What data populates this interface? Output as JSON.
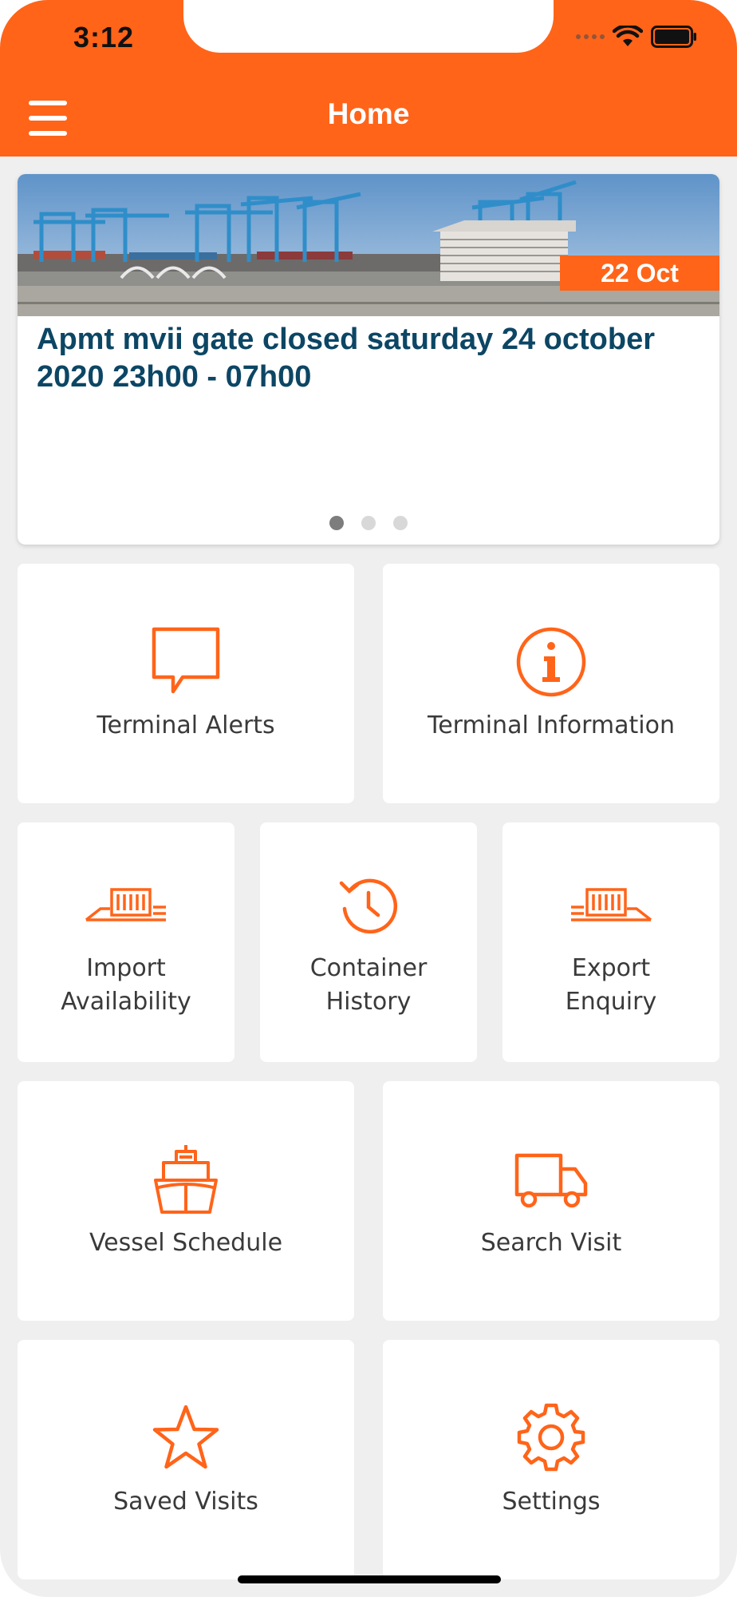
{
  "status_bar": {
    "time": "3:12"
  },
  "header": {
    "title": "Home"
  },
  "news": {
    "date": "22 Oct",
    "headline": "Apmt mvii gate closed saturday 24 october 2020 23h00 - 07h00",
    "page_count": 3,
    "active_page": 1
  },
  "tiles": {
    "terminal_alerts": "Terminal Alerts",
    "terminal_information": "Terminal Information",
    "import_line1": "Import",
    "import_line2": "Availability",
    "container_line1": "Container",
    "container_line2": "History",
    "export_line1": "Export",
    "export_line2": "Enquiry",
    "vessel_schedule": "Vessel Schedule",
    "search_visit": "Search Visit",
    "saved_visits": "Saved Visits",
    "settings": "Settings"
  },
  "colors": {
    "accent": "#ff6419",
    "headline": "#0c4664",
    "background": "#efefef"
  }
}
